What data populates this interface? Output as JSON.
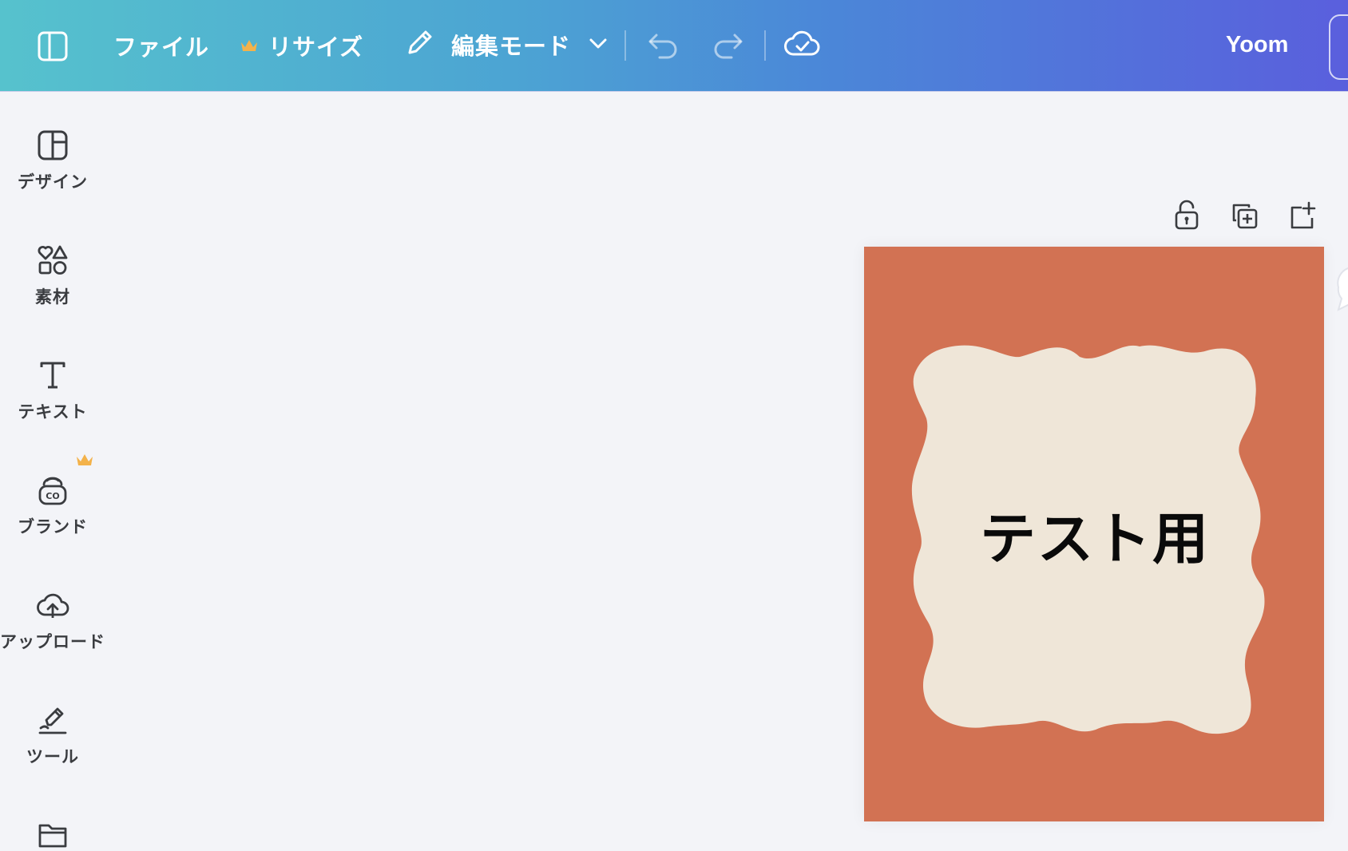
{
  "toolbar": {
    "file_label": "ファイル",
    "resize_label": "リサイズ",
    "edit_mode_label": "編集モード",
    "user_name": "Yoom",
    "crown_color": "#f3b24a",
    "icons": [
      "sidebar-toggle-icon",
      "crown-icon",
      "pencil-icon",
      "chevron-down-icon",
      "undo-icon",
      "redo-icon",
      "cloud-check-icon"
    ]
  },
  "sidebar": {
    "items": [
      {
        "label": "デザイン",
        "icon": "design-layout-icon"
      },
      {
        "label": "素材",
        "icon": "elements-shapes-icon"
      },
      {
        "label": "テキスト",
        "icon": "text-t-icon"
      },
      {
        "label": "ブランド",
        "icon": "brand-icon"
      },
      {
        "label": "アップロード",
        "icon": "cloud-upload-icon"
      },
      {
        "label": "ツール",
        "icon": "pen-tool-icon"
      },
      {
        "label": "",
        "icon": "folder-icon"
      }
    ]
  },
  "canvas": {
    "page_text": "テスト用",
    "page_color": "#d27253",
    "frame_color": "#efe6d8",
    "page_tool_icons": [
      "lock-icon",
      "duplicate-page-icon",
      "add-page-icon"
    ]
  }
}
